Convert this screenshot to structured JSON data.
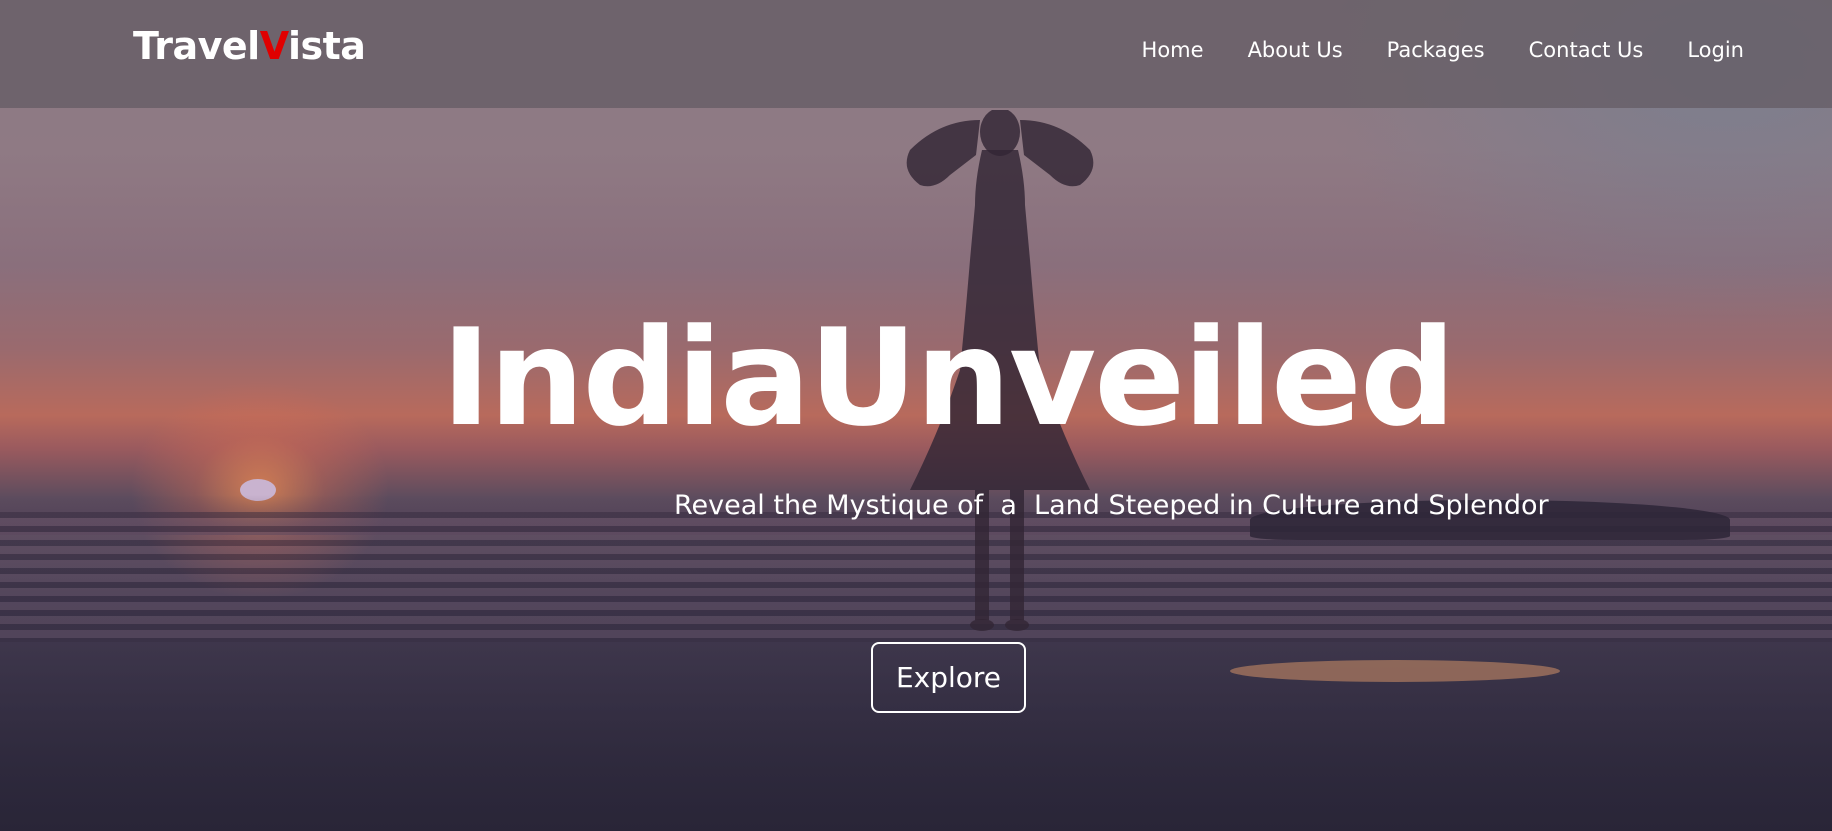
{
  "brand": {
    "name_prefix": "Travel",
    "name_accent": "V",
    "name_suffix": "ista",
    "accent_color": "#e00000"
  },
  "nav": {
    "items": [
      {
        "label": "Home"
      },
      {
        "label": "About Us"
      },
      {
        "label": "Packages"
      },
      {
        "label": "Contact Us"
      },
      {
        "label": "Login"
      }
    ]
  },
  "hero": {
    "title": "IndiaUnveiled",
    "subtitle": "Reveal the Mystique of  a  Land Steeped in Culture and Splendor",
    "cta_label": "Explore",
    "background_image": "sunset-beach-woman-silhouette"
  }
}
